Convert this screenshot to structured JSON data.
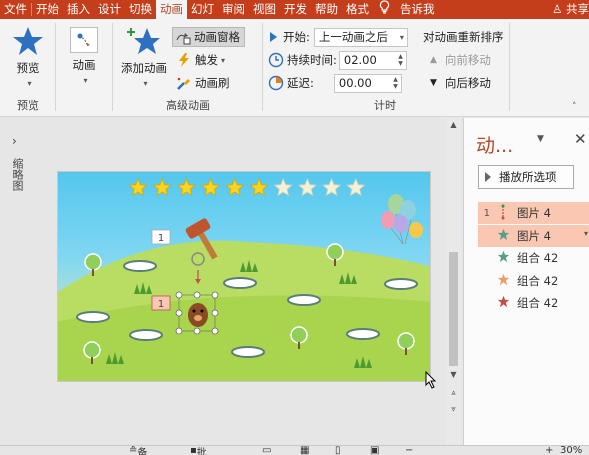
{
  "tabs": [
    "文件",
    "开始",
    "插入",
    "设计",
    "切换",
    "动画",
    "幻灯",
    "审阅",
    "视图",
    "开发",
    "帮助",
    "格式",
    "告诉我",
    "共享"
  ],
  "active_tab": "动画",
  "ribbon": {
    "preview": {
      "button": "预览",
      "group": "预览"
    },
    "animation": {
      "button": "动画"
    },
    "advanced": {
      "add_animation": "添加动画",
      "animation_pane": "动画窗格",
      "trigger": "触发",
      "animation_painter": "动画刷",
      "group": "高级动画"
    },
    "timing": {
      "start_label": "开始:",
      "start_value": "上一动画之后",
      "duration_label": "持续时间:",
      "duration_value": "02.00",
      "delay_label": "延迟:",
      "delay_value": "00.00",
      "reorder_title": "对动画重新排序",
      "move_earlier": "向前移动",
      "move_later": "向后移动",
      "group": "计时"
    }
  },
  "thumbnail_pane": {
    "label": "缩略图"
  },
  "slide": {
    "stars_filled": 6,
    "stars_total": 10,
    "tag_1": "1",
    "tag_2": "1"
  },
  "anim_pane": {
    "title": "动...",
    "play_button": "播放所选项",
    "items": [
      {
        "num": "1",
        "icon": "motion-path-icon",
        "label": "图片 4",
        "color": "#c0504d",
        "selected": true
      },
      {
        "num": "",
        "icon": "star-icon",
        "label": "图片 4",
        "color": "#5a9e8a",
        "selected": true
      },
      {
        "num": "",
        "icon": "star-icon",
        "label": "组合 42",
        "color": "#5a9e8a",
        "selected": false
      },
      {
        "num": "",
        "icon": "star-icon",
        "label": "组合 42",
        "color": "#e8a06a",
        "selected": false
      },
      {
        "num": "",
        "icon": "star-icon",
        "label": "组合 42",
        "color": "#c0504d",
        "selected": false
      }
    ]
  },
  "status": {
    "notes": "备注",
    "comments": "批注",
    "zoom": "30%"
  },
  "colors": {
    "accent": "#c43e1c",
    "selected_row": "#f9c7b2"
  }
}
